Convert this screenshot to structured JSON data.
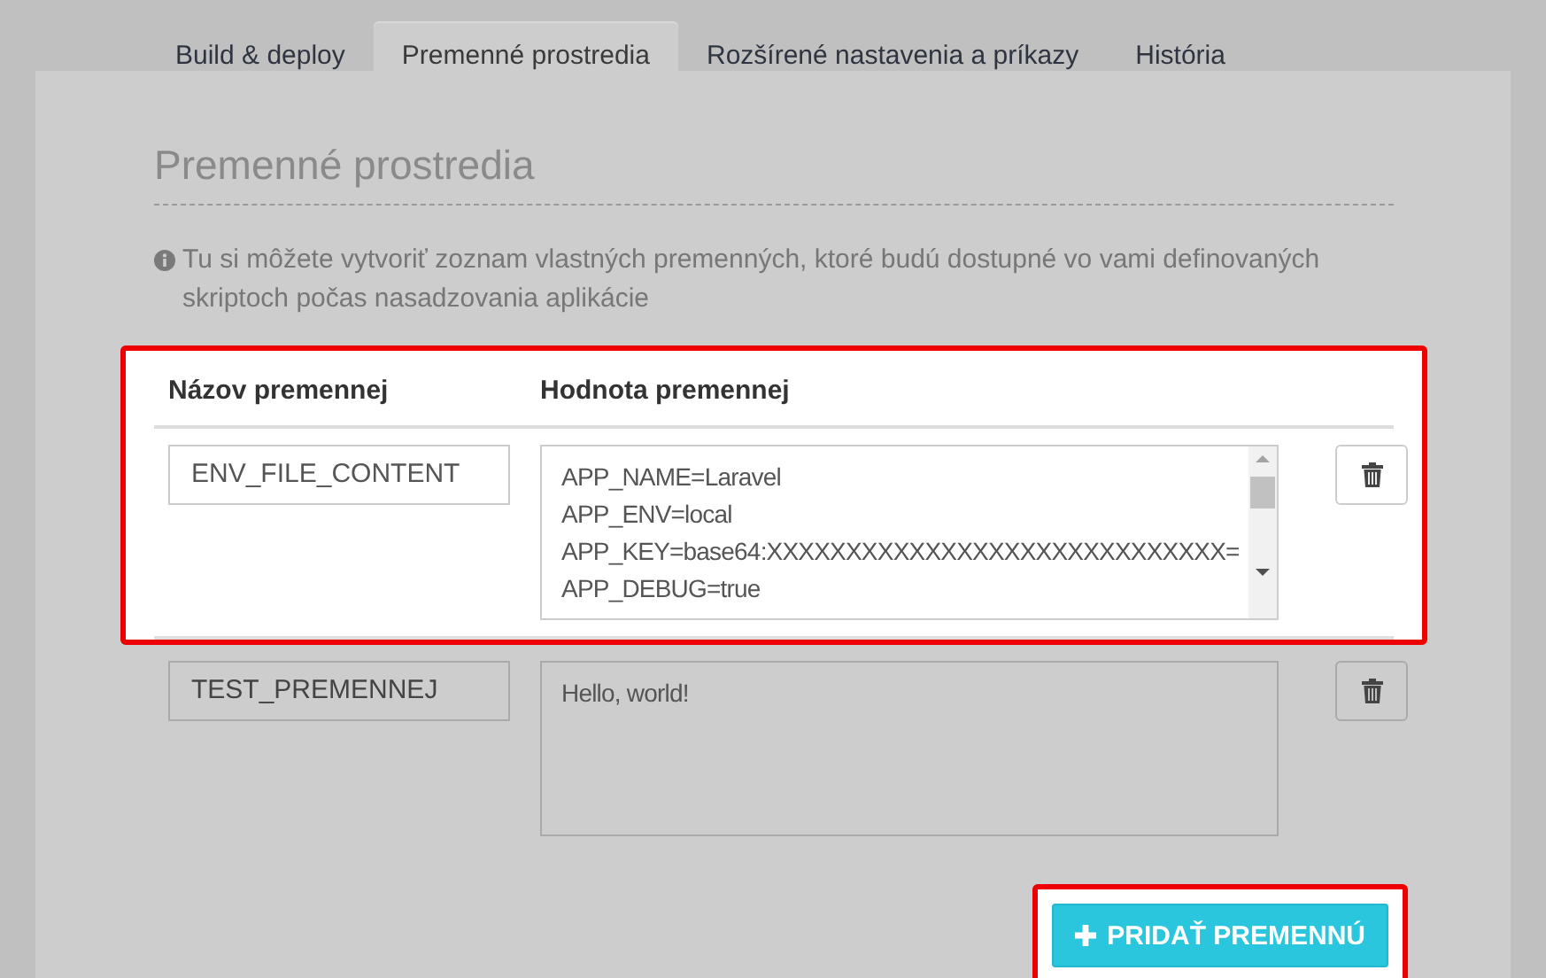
{
  "tabs": [
    {
      "label": "Build & deploy",
      "selected": false
    },
    {
      "label": "Premenné prostredia",
      "selected": true
    },
    {
      "label": "Rozšírené nastavenia a príkazy",
      "selected": false
    },
    {
      "label": "História",
      "selected": false
    }
  ],
  "section": {
    "title": "Premenné prostredia",
    "info": "Tu si môžete vytvoriť zoznam vlastných premenných, ktoré budú dostupné vo vami definovaných skriptoch počas nasadzovania aplikácie"
  },
  "table": {
    "columns": [
      "Názov premennej",
      "Hodnota premennej"
    ],
    "highlighted": true,
    "rows": [
      {
        "name": "ENV_FILE_CONTENT",
        "value": [
          "APP_NAME=Laravel",
          "APP_ENV=local",
          "APP_KEY=base64:XXXXXXXXXXXXXXXXXXXXXXXXXXXXX=",
          "APP_DEBUG=true"
        ],
        "scrollable": true,
        "highlighted": true
      },
      {
        "name": "TEST_PREMENNEJ",
        "value": [
          "Hello, world!"
        ],
        "scrollable": false,
        "highlighted": false
      }
    ]
  },
  "add_button": {
    "label": "PRIDAŤ PREMENNÚ",
    "highlighted": true
  }
}
